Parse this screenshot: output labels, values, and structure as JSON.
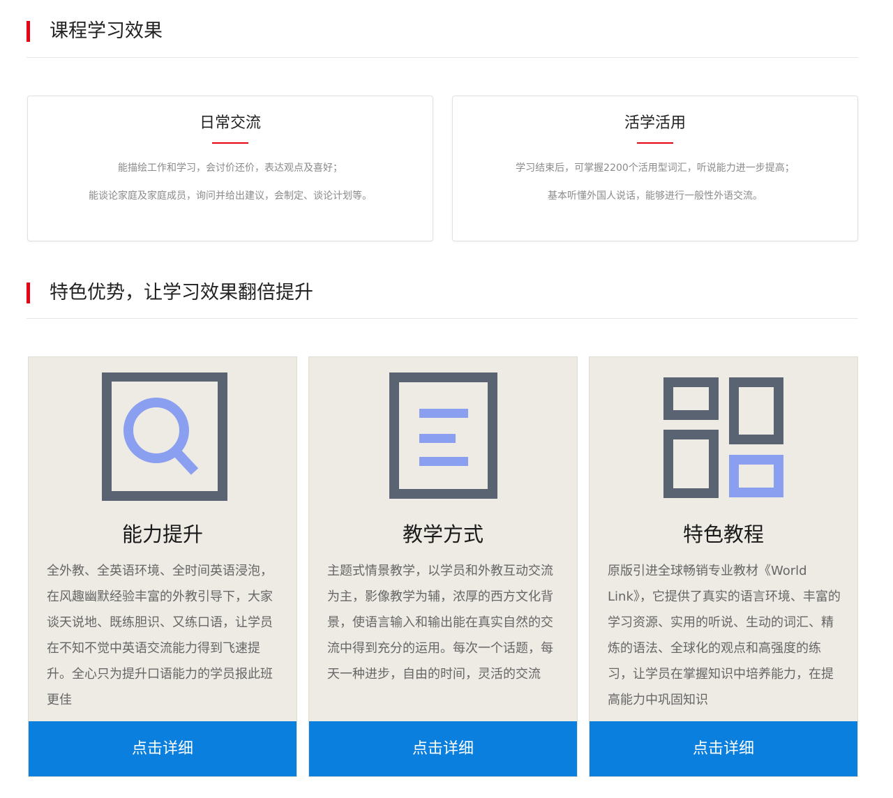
{
  "effects_section": {
    "title": "课程学习效果",
    "cards": [
      {
        "title": "日常交流",
        "lines": [
          "能描绘工作和学习，会讨价还价，表达观点及喜好；",
          "能谈论家庭及家庭成员，询问并给出建议，会制定、谈论计划等。"
        ]
      },
      {
        "title": "活学活用",
        "lines": [
          "学习结束后，可掌握2200个活用型词汇，听说能力进一步提高；",
          "基本听懂外国人说话，能够进行一般性外语交流。"
        ]
      }
    ]
  },
  "features_section": {
    "title": "特色优势，让学习效果翻倍提升",
    "cards": [
      {
        "icon": "search-icon",
        "title": "能力提升",
        "desc": "全外教、全英语环境、全时间英语浸泡，在风趣幽默经验丰富的外教引导下，大家谈天说地、既练胆识、又练口语，让学员在不知不觉中英语交流能力得到飞速提升。全心只为提升口语能力的学员报此班更佳",
        "button": "点击详细"
      },
      {
        "icon": "document-list-icon",
        "title": "教学方式",
        "desc": "主题式情景教学，以学员和外教互动交流为主，影像教学为辅，浓厚的西方文化背景，使语言输入和输出能在真实自然的交流中得到充分的运用。每次一个话题，每天一种进步，自由的时间，灵活的交流",
        "button": "点击详细"
      },
      {
        "icon": "grid-layout-icon",
        "title": "特色教程",
        "desc": "原版引进全球畅销专业教材《World Link》，它提供了真实的语言环境、丰富的学习资源、实用的听说、生动的词汇、精炼的语法、全球化的观点和高强度的练习，让学员在掌握知识中培养能力，在提高能力中巩固知识",
        "button": "点击详细"
      }
    ]
  },
  "colors": {
    "accent_red": "#e60012",
    "button_blue": "#0a7fde",
    "card_beige": "#eeebe4",
    "icon_dark": "#5a6372",
    "icon_blue": "#8a9ff0"
  }
}
